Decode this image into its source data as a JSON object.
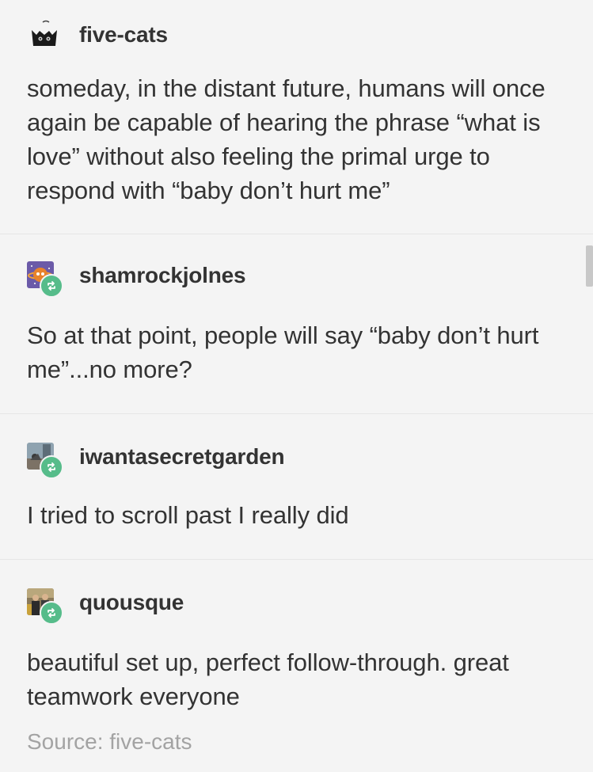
{
  "posts": [
    {
      "username": "five-cats",
      "avatar_icon": "black-cat-avatar-icon",
      "is_reblog": false,
      "text": "someday, in the distant future, humans will once again be capable of hearing the phrase “what is love” without also feeling the primal urge to  respond with “baby don’t hurt me”"
    },
    {
      "username": "shamrockjolnes",
      "avatar_icon": "space-planet-avatar-icon",
      "is_reblog": true,
      "text": "So at that point, people will say “baby don’t hurt me”...no more?"
    },
    {
      "username": "iwantasecretgarden",
      "avatar_icon": "garden-photo-avatar-icon",
      "is_reblog": true,
      "text": "I tried to scroll past I really did"
    },
    {
      "username": "quousque",
      "avatar_icon": "people-photo-avatar-icon",
      "is_reblog": true,
      "text": "beautiful set up, perfect follow-through. great teamwork everyone"
    }
  ],
  "source_label": "Source: five-cats",
  "colors": {
    "background": "#f4f4f4",
    "reblog_badge": "#56bc8a",
    "text": "#333333",
    "muted": "#a3a3a3"
  }
}
